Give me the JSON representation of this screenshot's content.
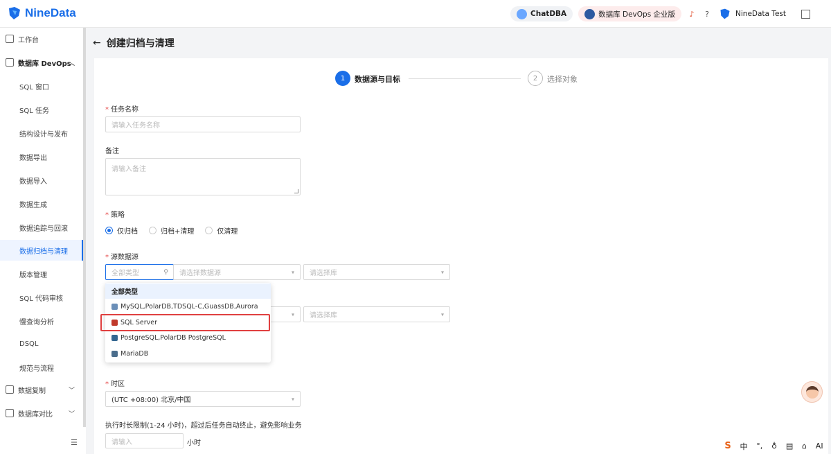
{
  "app": {
    "name": "NineData",
    "brand_color": "#1a6ee8"
  },
  "header": {
    "chatdba_label": "ChatDBA",
    "devops_label": "数据库 DevOps 企业版",
    "user_name": "NineData Test"
  },
  "sidebar": {
    "items": [
      {
        "label": "工作台",
        "level": "top"
      },
      {
        "label": "数据库 DevOps",
        "level": "top",
        "expanded": true
      },
      {
        "label": "SQL 窗口",
        "level": "sub"
      },
      {
        "label": "SQL 任务",
        "level": "sub"
      },
      {
        "label": "结构设计与发布",
        "level": "sub"
      },
      {
        "label": "数据导出",
        "level": "sub"
      },
      {
        "label": "数据导入",
        "level": "sub"
      },
      {
        "label": "数据生成",
        "level": "sub"
      },
      {
        "label": "数据追踪与回滚",
        "level": "sub"
      },
      {
        "label": "数据归档与清理",
        "level": "sub",
        "active": true
      },
      {
        "label": "版本管理",
        "level": "sub"
      },
      {
        "label": "SQL 代码审核",
        "level": "sub"
      },
      {
        "label": "慢查询分析",
        "level": "sub"
      },
      {
        "label": "DSQL",
        "level": "sub"
      },
      {
        "label": "规范与流程",
        "level": "sub"
      },
      {
        "label": "数据复制",
        "level": "top"
      },
      {
        "label": "数据库对比",
        "level": "top"
      }
    ]
  },
  "page": {
    "title": "创建归档与清理"
  },
  "steps": [
    {
      "number": "1",
      "label": "数据源与目标",
      "active": true
    },
    {
      "number": "2",
      "label": "选择对象",
      "active": false
    }
  ],
  "form": {
    "task_name_label": "任务名称",
    "task_name_placeholder": "请输入任务名称",
    "remark_label": "备注",
    "remark_placeholder": "请输入备注",
    "strategy_label": "策略",
    "strategy_options": [
      "仅归档",
      "归档+清理",
      "仅清理"
    ],
    "strategy_selected": "仅归档",
    "source_label": "源数据源",
    "type_placeholder": "全部类型",
    "datasource_placeholder": "请选择数据源",
    "db_placeholder": "请选择库",
    "target_db_placeholder": "请选择库",
    "timezone_label": "时区",
    "timezone_value": "(UTC +08:00) 北京/中国",
    "limit_label": "执行时长限制(1-24 小时)，超过后任务自动终止，避免影响业务",
    "limit_placeholder": "请输入",
    "limit_unit": "小时"
  },
  "type_dropdown": {
    "options": [
      {
        "label": "全部类型",
        "color": ""
      },
      {
        "label": "MySQL,PolarDB,TDSQL-C,GuassDB,Aurora",
        "color": "#6b8fb8"
      },
      {
        "label": "SQL Server",
        "color": "#c0392b",
        "highlighted": true
      },
      {
        "label": "PostgreSQL,PolarDB PostgreSQL",
        "color": "#336791"
      },
      {
        "label": "MariaDB",
        "color": "#4a6d8c"
      }
    ]
  },
  "ime_bar": {
    "items": [
      "中",
      "°,",
      "AI"
    ]
  }
}
